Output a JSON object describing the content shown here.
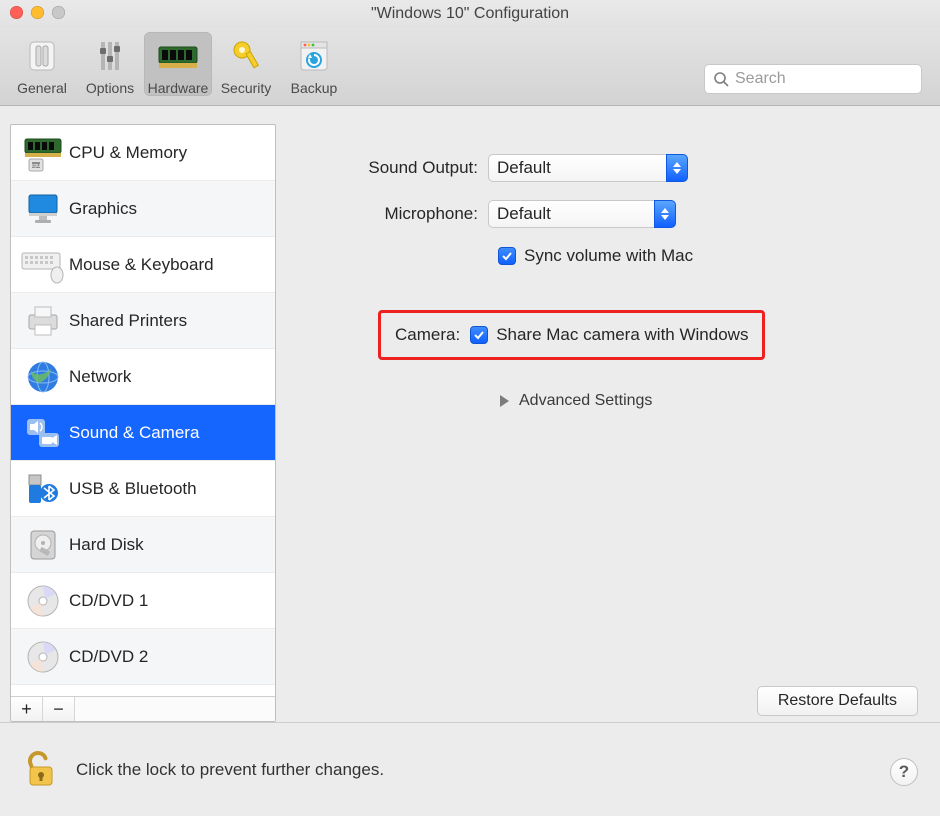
{
  "window": {
    "title": "\"Windows 10\" Configuration"
  },
  "toolbar": {
    "items": [
      {
        "label": "General",
        "selected": false
      },
      {
        "label": "Options",
        "selected": false
      },
      {
        "label": "Hardware",
        "selected": true
      },
      {
        "label": "Security",
        "selected": false
      },
      {
        "label": "Backup",
        "selected": false
      }
    ],
    "search_placeholder": "Search"
  },
  "sidebar": {
    "items": [
      {
        "label": "CPU & Memory",
        "icon": "cpu-icon"
      },
      {
        "label": "Graphics",
        "icon": "monitor-icon"
      },
      {
        "label": "Mouse & Keyboard",
        "icon": "keyboard-icon"
      },
      {
        "label": "Shared Printers",
        "icon": "printer-icon"
      },
      {
        "label": "Network",
        "icon": "globe-icon"
      },
      {
        "label": "Sound & Camera",
        "icon": "sound-camera-icon",
        "selected": true
      },
      {
        "label": "USB & Bluetooth",
        "icon": "usb-bt-icon"
      },
      {
        "label": "Hard Disk",
        "icon": "hdd-icon"
      },
      {
        "label": "CD/DVD 1",
        "icon": "cd-icon"
      },
      {
        "label": "CD/DVD 2",
        "icon": "cd-icon"
      }
    ],
    "add_label": "+",
    "remove_label": "−"
  },
  "pane": {
    "sound_output_label": "Sound Output:",
    "sound_output_value": "Default",
    "microphone_label": "Microphone:",
    "microphone_value": "Default",
    "sync_volume_label": "Sync volume with Mac",
    "sync_volume_checked": true,
    "camera_label": "Camera:",
    "camera_checkbox_label": "Share Mac camera with Windows",
    "camera_checkbox_checked": true,
    "advanced_label": "Advanced Settings",
    "restore_label": "Restore Defaults"
  },
  "lockbar": {
    "message": "Click the lock to prevent further changes.",
    "help_label": "?"
  }
}
